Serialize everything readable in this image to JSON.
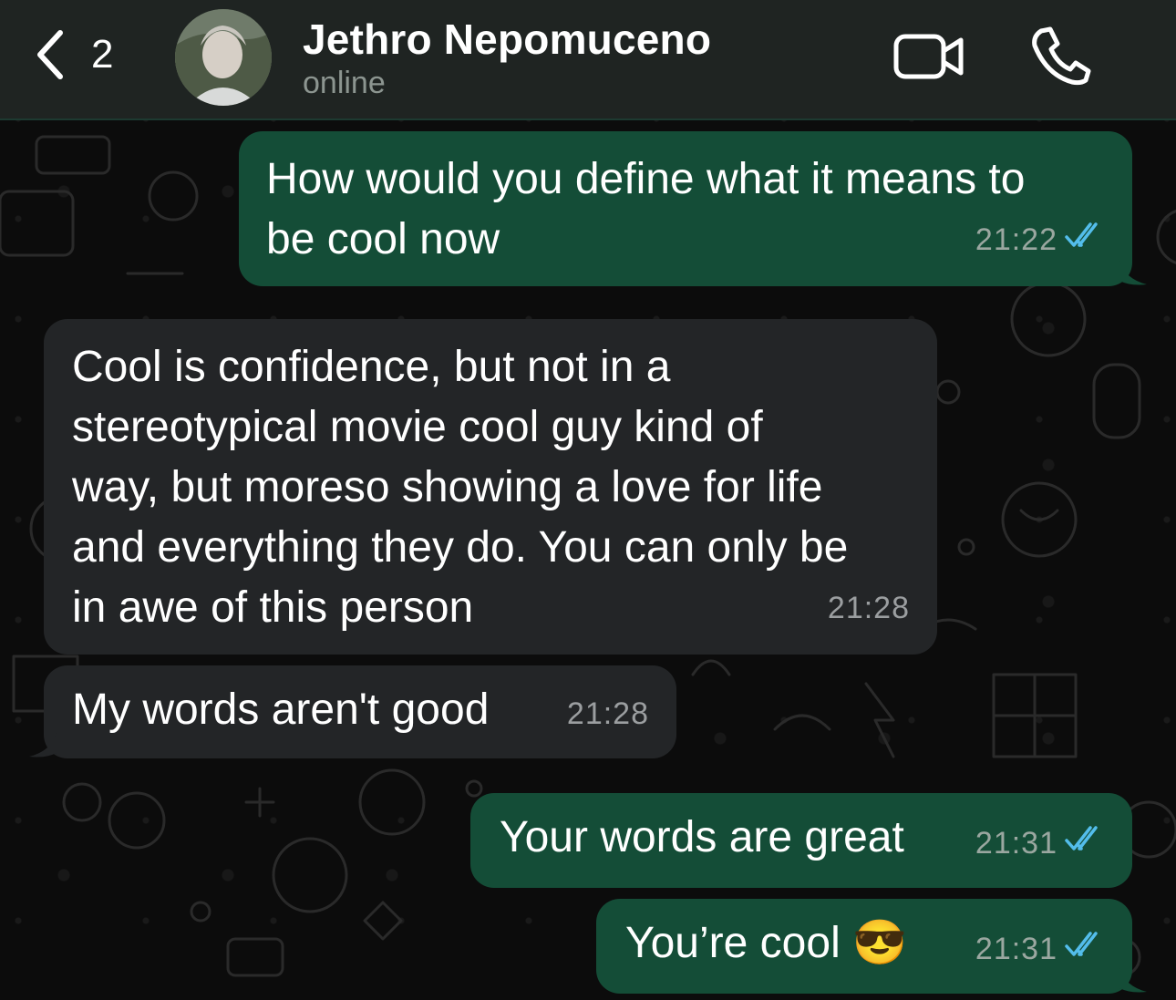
{
  "header": {
    "back_count": "2",
    "contact_name": "Jethro Nepomuceno",
    "contact_status": "online"
  },
  "icons": {
    "back": "chevron-left-icon",
    "video": "video-camera-icon",
    "call": "phone-icon",
    "read": "double-check-icon",
    "emoji": "sunglasses-emoji"
  },
  "colors": {
    "outgoing_bubble": "#144d37",
    "incoming_bubble": "#232527",
    "read_ticks": "#53bdeb"
  },
  "messages": [
    {
      "direction": "outgoing",
      "text": "How would you define what it means to\nbe cool now",
      "time": "21:22",
      "read": true
    },
    {
      "direction": "incoming",
      "text": "Cool is confidence, but not in a\nstereotypical movie cool guy kind of\nway, but moreso showing a love for life\nand everything they do. You can only be\nin awe of this person",
      "time": "21:28"
    },
    {
      "direction": "incoming",
      "text": "My words aren't good",
      "time": "21:28"
    },
    {
      "direction": "outgoing",
      "text": "Your words are great",
      "time": "21:31",
      "read": true
    },
    {
      "direction": "outgoing",
      "text": "You’re cool 😎",
      "time": "21:31",
      "read": true
    }
  ]
}
